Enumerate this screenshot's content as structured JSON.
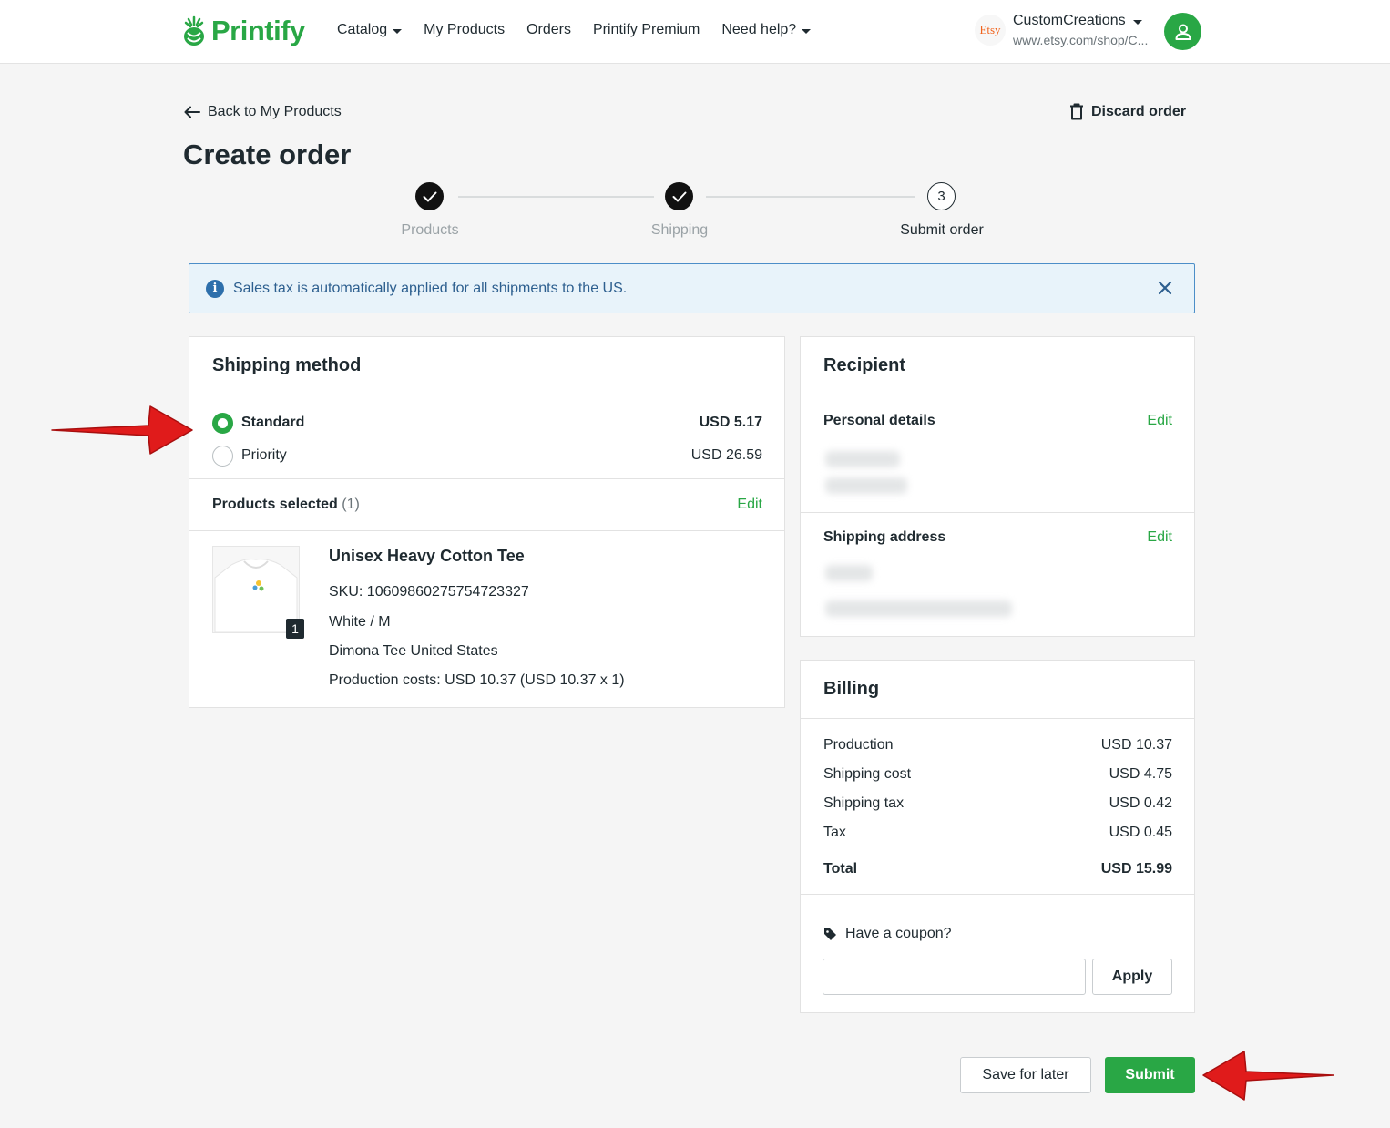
{
  "header": {
    "logo_text": "Printify",
    "nav": [
      {
        "label": "Catalog",
        "has_dropdown": true
      },
      {
        "label": "My Products",
        "has_dropdown": false
      },
      {
        "label": "Orders",
        "has_dropdown": false
      },
      {
        "label": "Printify Premium",
        "has_dropdown": false
      },
      {
        "label": "Need help?",
        "has_dropdown": true
      }
    ],
    "store_badge": "Etsy",
    "store_name": "CustomCreations",
    "store_url": "www.etsy.com/shop/C..."
  },
  "page": {
    "back_label": "Back to My Products",
    "discard_label": "Discard order",
    "title": "Create order"
  },
  "stepper": {
    "steps": [
      {
        "label": "Products",
        "status": "done"
      },
      {
        "label": "Shipping",
        "status": "done"
      },
      {
        "label": "Submit order",
        "status": "current",
        "number": "3"
      }
    ]
  },
  "alert": {
    "text": "Sales tax is automatically applied for all shipments to the US.",
    "icon": "info-icon"
  },
  "shipping_method": {
    "title": "Shipping method",
    "options": [
      {
        "label": "Standard",
        "price": "USD 5.17",
        "selected": true
      },
      {
        "label": "Priority",
        "price": "USD 26.59",
        "selected": false
      }
    ],
    "products_selected_label": "Products selected",
    "products_selected_count": "(1)",
    "edit_label": "Edit",
    "product": {
      "name": "Unisex Heavy Cotton Tee",
      "sku": "SKU: 10609860275754723327",
      "variant": "White / M",
      "provider": "Dimona Tee United States",
      "production_costs": "Production costs: USD 10.37 (USD 10.37 x 1)",
      "quantity": "1"
    }
  },
  "recipient": {
    "title": "Recipient",
    "personal_details_label": "Personal details",
    "shipping_address_label": "Shipping address",
    "edit_label": "Edit"
  },
  "billing": {
    "title": "Billing",
    "lines": [
      {
        "label": "Production",
        "value": "USD 10.37"
      },
      {
        "label": "Shipping cost",
        "value": "USD 4.75"
      },
      {
        "label": "Shipping tax",
        "value": "USD 0.42"
      },
      {
        "label": "Tax",
        "value": "USD 0.45"
      }
    ],
    "total_label": "Total",
    "total_value": "USD 15.99",
    "coupon_label": "Have a coupon?",
    "coupon_placeholder": "",
    "apply_label": "Apply"
  },
  "actions": {
    "save_label": "Save for later",
    "submit_label": "Submit"
  },
  "colors": {
    "brand": "#29a745",
    "alert_bg": "#e8f3fa",
    "alert_border": "#4c8ec8",
    "annotation_arrow": "#e01b1b"
  }
}
